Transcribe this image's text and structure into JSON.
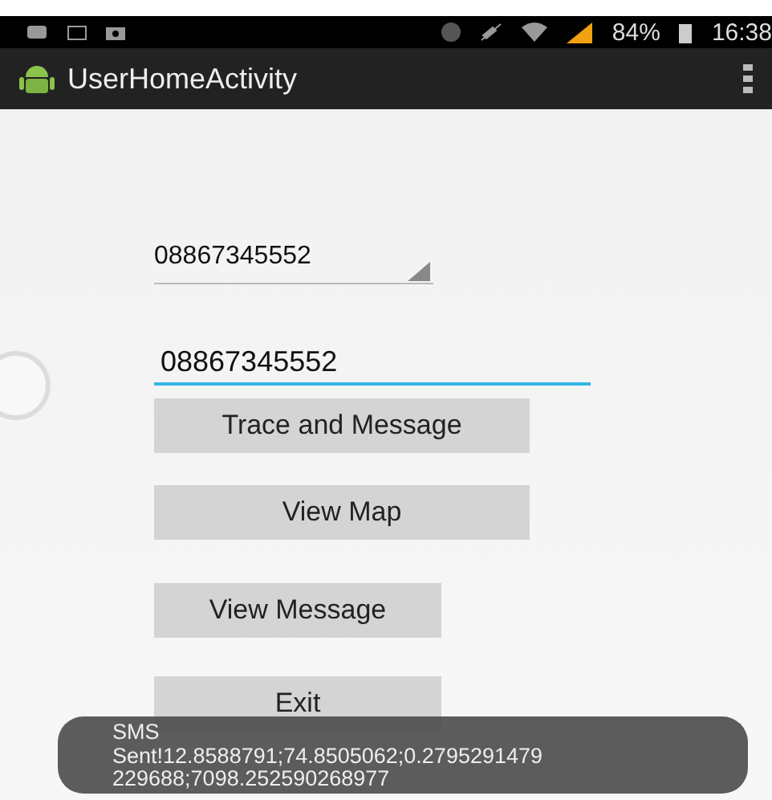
{
  "status_bar": {
    "battery": "84%",
    "time": "16:38"
  },
  "action_bar": {
    "title": "UserHomeActivity"
  },
  "spinner": {
    "value": "08867345552"
  },
  "phone_field": {
    "value": "08867345552",
    "focused": true
  },
  "buttons": [
    {
      "label": "Trace and Message"
    },
    {
      "label": "View Map"
    },
    {
      "label": "View Message"
    },
    {
      "label": "Exit"
    }
  ],
  "toast": {
    "lines": [
      "SMS",
      "Sent!12.8588791;74.8505062;0.2795291479",
      "229688;7098.252590268977"
    ]
  }
}
